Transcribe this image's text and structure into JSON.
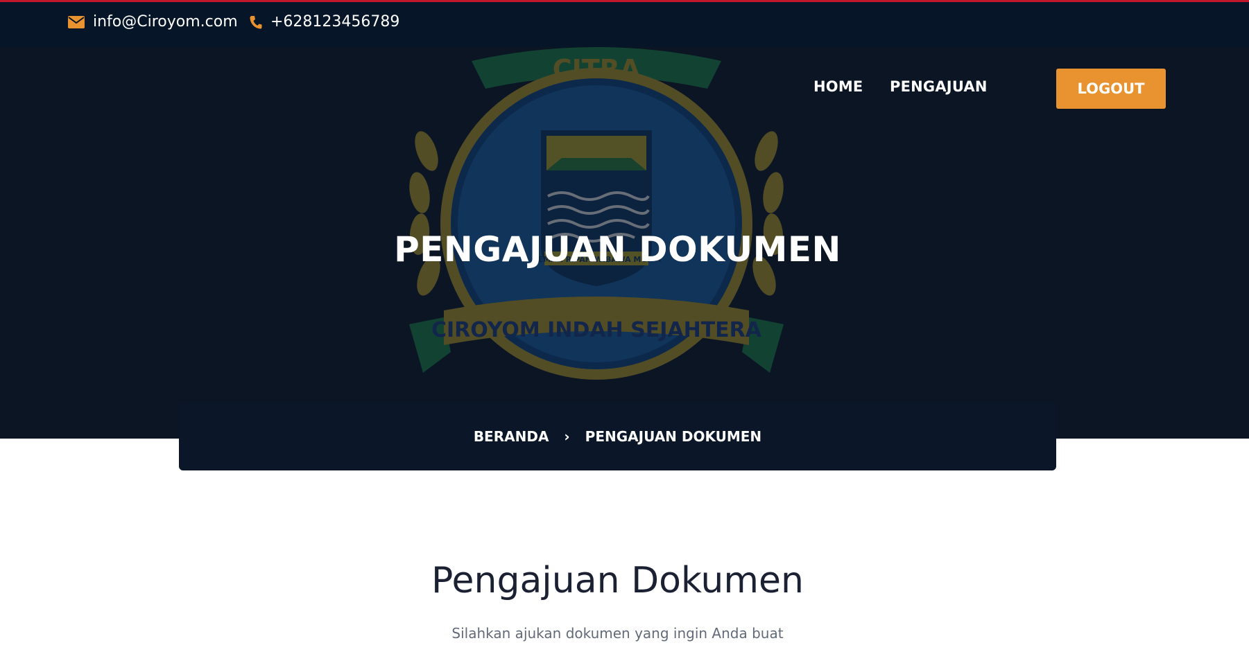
{
  "topbar": {
    "email": "info@Ciroyom.com",
    "phone": "+628123456789",
    "email_icon": "envelope-icon",
    "phone_icon": "phone-icon",
    "accent_color": "#e8932f",
    "border_color": "#c0182b"
  },
  "nav": {
    "items": [
      {
        "label": "HOME"
      },
      {
        "label": "PENGAJUAN"
      }
    ],
    "logout_label": "LOGOUT",
    "logout_color": "#e8932f"
  },
  "hero": {
    "title": "PENGAJUAN DOKUMEN",
    "emblem": {
      "top_text": "CITRA",
      "banner_text": "CIROYOM INDAH SEJAHTERA",
      "motto": "GEMAH RIPAH WIBAWA MUKTI"
    }
  },
  "breadcrumb": {
    "home": "BERANDA",
    "separator": "›",
    "current": "PENGAJUAN DOKUMEN"
  },
  "main": {
    "title": "Pengajuan Dokumen",
    "subtitle": "Silahkan ajukan dokumen yang ingin Anda buat"
  }
}
